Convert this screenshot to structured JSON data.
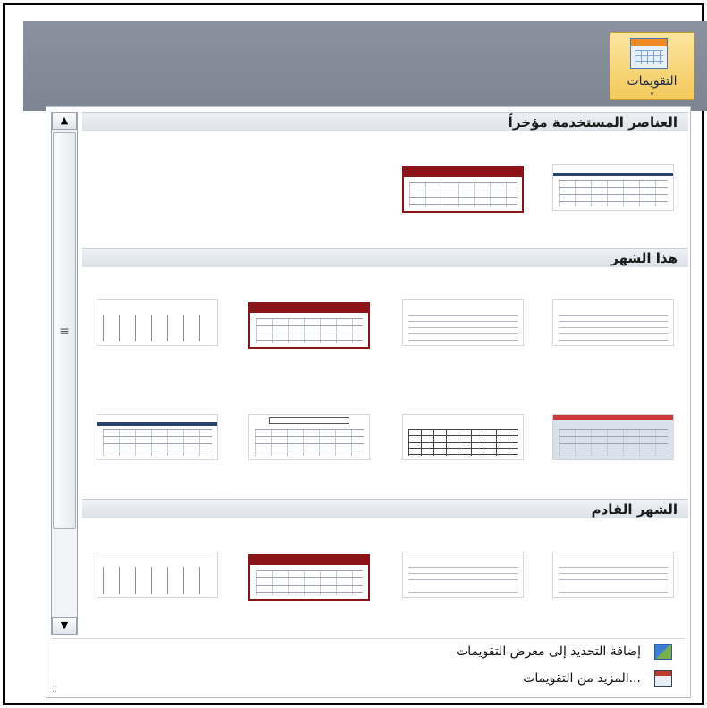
{
  "ribbon": {
    "calendars_button_label": "التقويمات",
    "dropdown_arrow": "▾"
  },
  "gallery": {
    "scroll_up": "▲",
    "scroll_down": "▼",
    "thumb_grip": "≡",
    "sections": [
      {
        "label": "العناصر المستخدمة مؤخراً"
      },
      {
        "label": "هذا الشهر"
      },
      {
        "label": "الشهر القادم"
      }
    ]
  },
  "footer": {
    "add_selection_label": "إضافة التحديد إلى معرض التقويمات",
    "more_calendars_label": "المزيد من التقويمات...",
    "resize_grip": "⁚⁚"
  },
  "colors": {
    "ribbon_bg": "#7d8593",
    "button_highlight": "#f3c95a",
    "template_red": "#8b1418",
    "template_navy": "#27436b"
  }
}
